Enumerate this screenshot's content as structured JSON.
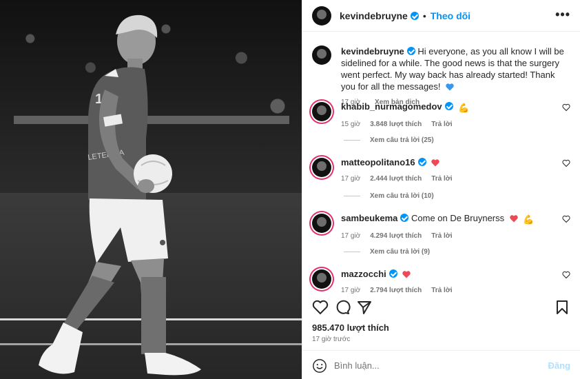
{
  "post": {
    "username": "kevindebruyne",
    "follow_label": "Theo dõi",
    "more_label": "•••",
    "caption": "Hi everyone, as you all know I will be sidelined for a while. The good news is that the surgery went perfect. My way back has already started! Thank you for all the messages!",
    "caption_time": "17 giờ",
    "translate_label": "Xem bản dịch",
    "shirt_text": "LETERSIA"
  },
  "comments": [
    {
      "username": "khabib_nurmagomedov",
      "text": "",
      "emoji": "flexed-biceps",
      "time": "15 giờ",
      "likes": "3.848 lượt thích",
      "reply": "Trả lời",
      "view_replies": "Xem câu trả lời (25)"
    },
    {
      "username": "matteopolitano16",
      "text": "",
      "emoji": "red-heart",
      "time": "17 giờ",
      "likes": "2.444 lượt thích",
      "reply": "Trả lời",
      "view_replies": "Xem câu trả lời (10)"
    },
    {
      "username": "sambeukema",
      "text": "Come on De Bruynerss",
      "emoji": "red-heart",
      "emoji2": "flexed-biceps",
      "time": "17 giờ",
      "likes": "4.294 lượt thích",
      "reply": "Trả lời",
      "view_replies": "Xem câu trả lời (9)"
    },
    {
      "username": "mazzocchi",
      "text": "",
      "emoji": "red-heart",
      "time": "17 giờ",
      "likes": "2.794 lượt thích",
      "reply": "Trả lời",
      "view_replies": ""
    }
  ],
  "footer": {
    "likes": "985.470 lượt thích",
    "ago": "17 giờ trước",
    "comment_placeholder": "Bình luận...",
    "post_label": "Đăng"
  },
  "colors": {
    "accent": "#0095f6",
    "heart": "#ed4956",
    "blue_heart": "#3897f0"
  }
}
